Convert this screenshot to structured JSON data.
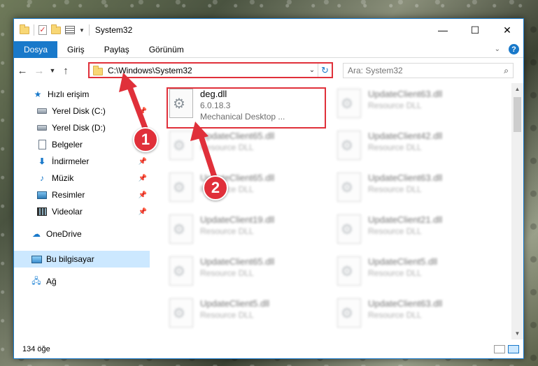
{
  "window": {
    "title": "System32",
    "controls": {
      "minimize": "—",
      "maximize": "☐",
      "close": "✕"
    }
  },
  "ribbon": {
    "tabs": [
      {
        "label": "Dosya"
      },
      {
        "label": "Giriş"
      },
      {
        "label": "Paylaş"
      },
      {
        "label": "Görünüm"
      }
    ],
    "help": "?"
  },
  "navbar": {
    "path": "C:\\Windows\\System32",
    "search_placeholder": "Ara: System32"
  },
  "sidebar": {
    "items": [
      {
        "label": "Hızlı erişim",
        "icon": "star-icon"
      },
      {
        "label": "Yerel Disk (C:)",
        "icon": "drive-icon"
      },
      {
        "label": "Yerel Disk (D:)",
        "icon": "drive-icon"
      },
      {
        "label": "Belgeler",
        "icon": "documents-icon"
      },
      {
        "label": "İndirmeler",
        "icon": "download-icon"
      },
      {
        "label": "Müzik",
        "icon": "music-icon"
      },
      {
        "label": "Resimler",
        "icon": "pictures-icon"
      },
      {
        "label": "Videolar",
        "icon": "videos-icon"
      },
      {
        "label": "OneDrive",
        "icon": "onedrive-icon"
      },
      {
        "label": "Bu bilgisayar",
        "icon": "this-pc-icon"
      },
      {
        "label": "Ağ",
        "icon": "network-icon"
      }
    ]
  },
  "files": [
    {
      "name": "deg.dll",
      "line1": "6.0.18.3",
      "line2": "Mechanical Desktop ..."
    },
    {
      "name": "UpdateClient63.dll",
      "line1": "Resource DLL"
    },
    {
      "name": "UpdateClient65.dll",
      "line1": "Resource DLL"
    },
    {
      "name": "UpdateClient42.dll",
      "line1": "Resource DLL"
    },
    {
      "name": "UpdateClient65.dll",
      "line1": "Resource DLL"
    },
    {
      "name": "UpdateClient63.dll",
      "line1": "Resource DLL"
    },
    {
      "name": "UpdateClient19.dll",
      "line1": "Resource DLL"
    },
    {
      "name": "UpdateClient21.dll",
      "line1": "Resource DLL"
    },
    {
      "name": "UpdateClient65.dll",
      "line1": "Resource DLL"
    },
    {
      "name": "UpdateClient5.dll",
      "line1": "Resource DLL"
    },
    {
      "name": "UpdateClient5.dll",
      "line1": "Resource DLL"
    },
    {
      "name": "UpdateClient63.dll",
      "line1": "Resource DLL"
    }
  ],
  "status": {
    "item_count": "134 öğe"
  },
  "annotations": {
    "step1": "1",
    "step2": "2",
    "color": "#e0303a"
  }
}
